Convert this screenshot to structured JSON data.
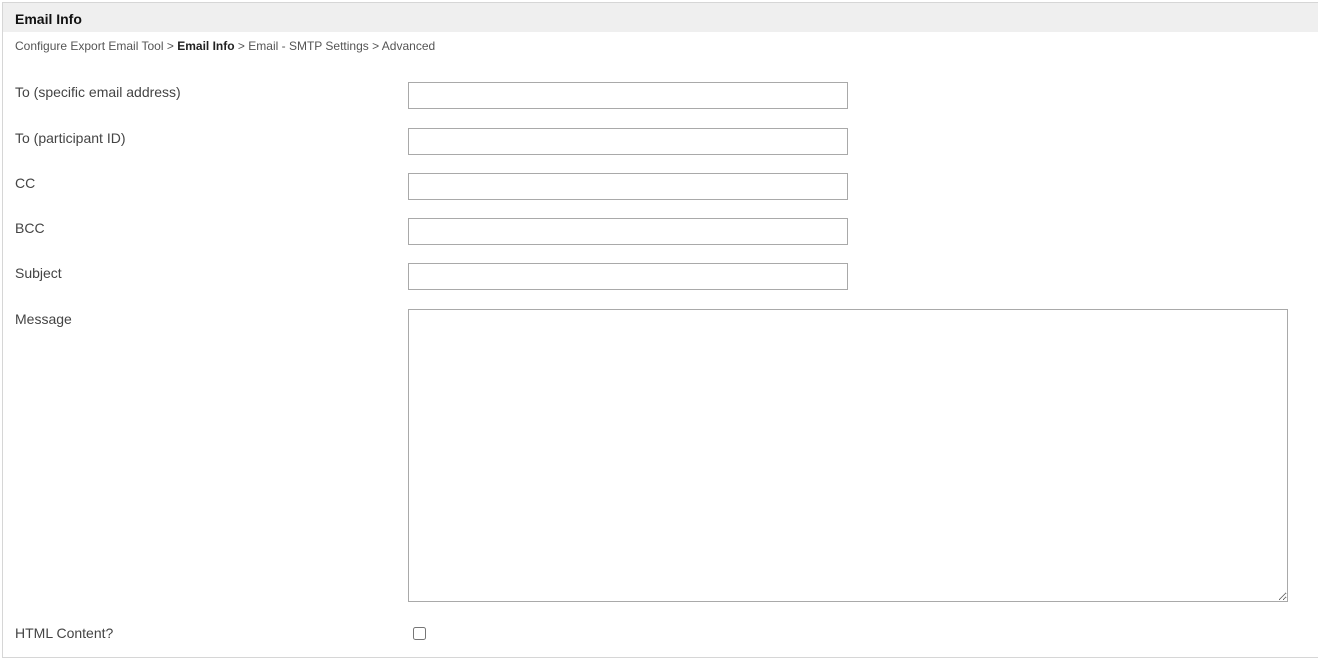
{
  "panel": {
    "title": "Email Info"
  },
  "breadcrumb": {
    "items": [
      {
        "label": "Configure Export Email Tool",
        "current": false
      },
      {
        "label": "Email Info",
        "current": true
      },
      {
        "label": "Email - SMTP Settings",
        "current": false
      },
      {
        "label": "Advanced",
        "current": false
      }
    ],
    "separator": ">"
  },
  "form": {
    "to_email": {
      "label": "To (specific email address)",
      "value": ""
    },
    "to_participant": {
      "label": "To (participant ID)",
      "value": ""
    },
    "cc": {
      "label": "CC",
      "value": ""
    },
    "bcc": {
      "label": "BCC",
      "value": ""
    },
    "subject": {
      "label": "Subject",
      "value": ""
    },
    "message": {
      "label": "Message",
      "value": ""
    },
    "html_content": {
      "label": "HTML Content?",
      "checked": false
    }
  }
}
